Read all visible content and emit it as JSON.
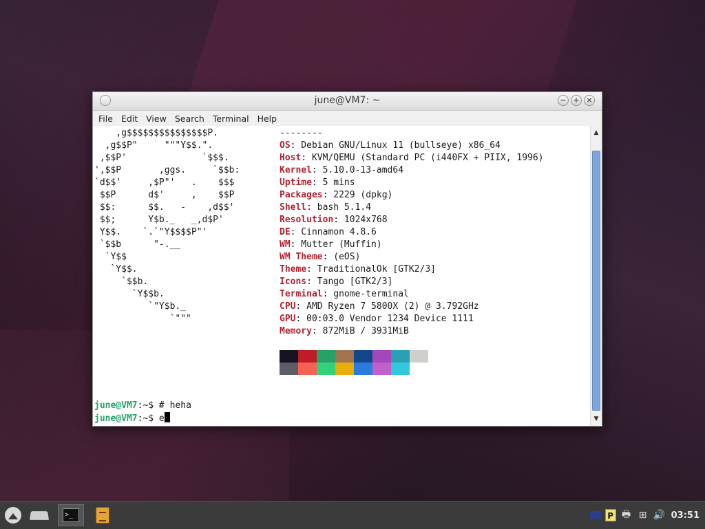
{
  "window": {
    "title": "june@VM7: ~",
    "buttons": {
      "minimize": "−",
      "maximize": "+",
      "close": "×"
    }
  },
  "menu": [
    "File",
    "Edit",
    "View",
    "Search",
    "Terminal",
    "Help"
  ],
  "logo_lines": [
    "    ,g$$$$$$$$$$$$$$$P.",
    "  ,g$$P\"     \"\"\"Y$$.\".",
    " ,$$P'              `$$$.",
    "',$$P       ,ggs.     `$$b:",
    "`d$$'     ,$P\"'   .    $$$",
    " $$P      d$'     ,    $$P",
    " $$:      $$.   -    ,d$$'",
    " $$;      Y$b._   _,d$P'",
    " Y$$.    `.`\"Y$$$$P\"'",
    " `$$b      \"-.__",
    "  `Y$$",
    "   `Y$$.",
    "     `$$b.",
    "       `Y$$b.",
    "          `\"Y$b._",
    "              `\"\"\""
  ],
  "separator": "--------",
  "info": [
    {
      "key": "OS",
      "value": " Debian GNU/Linux 11 (bullseye) x86_64"
    },
    {
      "key": "Host",
      "value": " KVM/QEMU (Standard PC (i440FX + PIIX, 1996)"
    },
    {
      "key": "Kernel",
      "value": " 5.10.0-13-amd64"
    },
    {
      "key": "Uptime",
      "value": " 5 mins"
    },
    {
      "key": "Packages",
      "value": " 2229 (dpkg)"
    },
    {
      "key": "Shell",
      "value": " bash 5.1.4"
    },
    {
      "key": "Resolution",
      "value": " 1024x768"
    },
    {
      "key": "DE",
      "value": " Cinnamon 4.8.6"
    },
    {
      "key": "WM",
      "value": " Mutter (Muffin)"
    },
    {
      "key": "WM Theme",
      "value": " (eOS)"
    },
    {
      "key": "Theme",
      "value": " TraditionalOk [GTK2/3]"
    },
    {
      "key": "Icons",
      "value": " Tango [GTK2/3]"
    },
    {
      "key": "Terminal",
      "value": " gnome-terminal"
    },
    {
      "key": "CPU",
      "value": " AMD Ryzen 7 5800X (2) @ 3.792GHz"
    },
    {
      "key": "GPU",
      "value": " 00:03.0 Vendor 1234 Device 1111"
    },
    {
      "key": "Memory",
      "value": " 872MiB / 3931MiB"
    }
  ],
  "palette_row1": [
    "#171421",
    "#c01c28",
    "#26a269",
    "#a2734c",
    "#12488b",
    "#a347ba",
    "#2aa1b3",
    "#d0cfcc"
  ],
  "palette_row2": [
    "#5e5c64",
    "#f66151",
    "#33d17a",
    "#e9ad0c",
    "#2a7bde",
    "#c061cb",
    "#33c7de",
    "#ffffff"
  ],
  "prompts": [
    {
      "user": "june@VM7",
      "rest": ":~$ # heha"
    },
    {
      "user": "june@VM7",
      "rest": ":~$ e"
    }
  ],
  "taskbar": {
    "clock": "03:51",
    "icons": [
      "menu-icon",
      "show-desktop-icon",
      "terminal-icon",
      "files-icon",
      "keyboard-layout-icon",
      "panel-p-icon",
      "printer-icon",
      "network-icon",
      "volume-icon"
    ]
  }
}
